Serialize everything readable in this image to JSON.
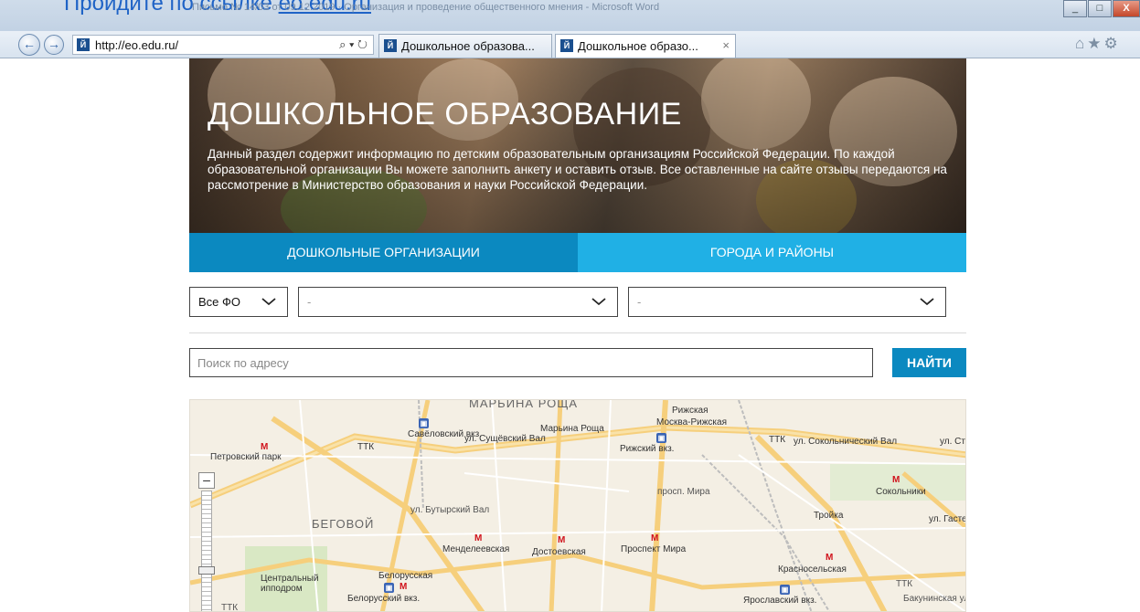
{
  "overlay": {
    "doc_title": "Письмо № 14/03 от 09.12.2019 · Организация и проведение общественного мнения - Microsoft Word",
    "link_text_prefix": "Пройдите по ссылке ",
    "link_text": "eo.edu.ru"
  },
  "window": {
    "min": "_",
    "max": "□",
    "close": "X"
  },
  "browser": {
    "url": "http://eo.edu.ru/",
    "address_tools": "⌕ ▾ ↻",
    "tabs": [
      {
        "label": "Дошкольное образова...",
        "active": false
      },
      {
        "label": "Дошкольное образо...",
        "active": true,
        "close": "×"
      }
    ],
    "right_icons": "⌂★⚙"
  },
  "hero": {
    "title": "ДОШКОЛЬНОЕ ОБРАЗОВАНИЕ",
    "description": "Данный раздел содержит информацию по детским образовательным организациям Российской Федерации. По каждой образовательной организации Вы можете заполнить анкету и оставить отзыв. Все оставленные на сайте отзывы передаются на рассмотрение в Министерство образования и науки Российской Федерации."
  },
  "tabs": {
    "organizations": "Дошкольные организации",
    "cities": "Города и районы"
  },
  "filters": {
    "fo": "Все ФО",
    "region": "-",
    "district": "-"
  },
  "search": {
    "placeholder": "Поиск по адресу",
    "button": "Найти"
  },
  "map": {
    "labels": {
      "marina_top": "МАРЬИНА РОЩА",
      "savelovsky": "Савёловский вкз.",
      "marina_roscha": "Марьина Роща",
      "rizhskaya_top": "Рижская",
      "moskva_rizhskaya": "Москва-Рижская",
      "rizhsky_vkz": "Рижский вкз.",
      "suschevsky": "ул. Сущёвский Вал",
      "ttk_1": "ТТК",
      "ttk_2": "ТТК",
      "ttk_3": "ТТК",
      "ttk_4": "ТТК",
      "petrovsky": "Петровский парк",
      "sokolnichesky": "ул. Сокольнический Вал",
      "sokolniki": "Сокольники",
      "ul_st": "ул. Ст",
      "prosp_mira_v": "просп. Мира",
      "butyrsky": "ул. Бутырский Вал",
      "begovoy": "БЕГОВОЙ",
      "troyka": "Тройка",
      "gastello": "ул. Гастелло",
      "mendeleevskaya": "Менделеевская",
      "dostoevskaya": "Достоевская",
      "prospekt_mira": "Проспект Мира",
      "tsentralny": "Центральный\nипподром",
      "belorusskaya": "Белорусская",
      "belorussky_vkz": "Белорусский вкз.",
      "krasnoselskaya": "Красносельская",
      "yaroslavsky": "Ярославский вкз.",
      "bakuninskaya": "Бакунинская ул."
    },
    "zoom_minus": "–"
  },
  "colors": {
    "tab_primary": "#0b89c0",
    "tab_secondary": "#20b0e5",
    "metro_red": "#d0121b",
    "road_yellow": "#f6cf7c"
  }
}
